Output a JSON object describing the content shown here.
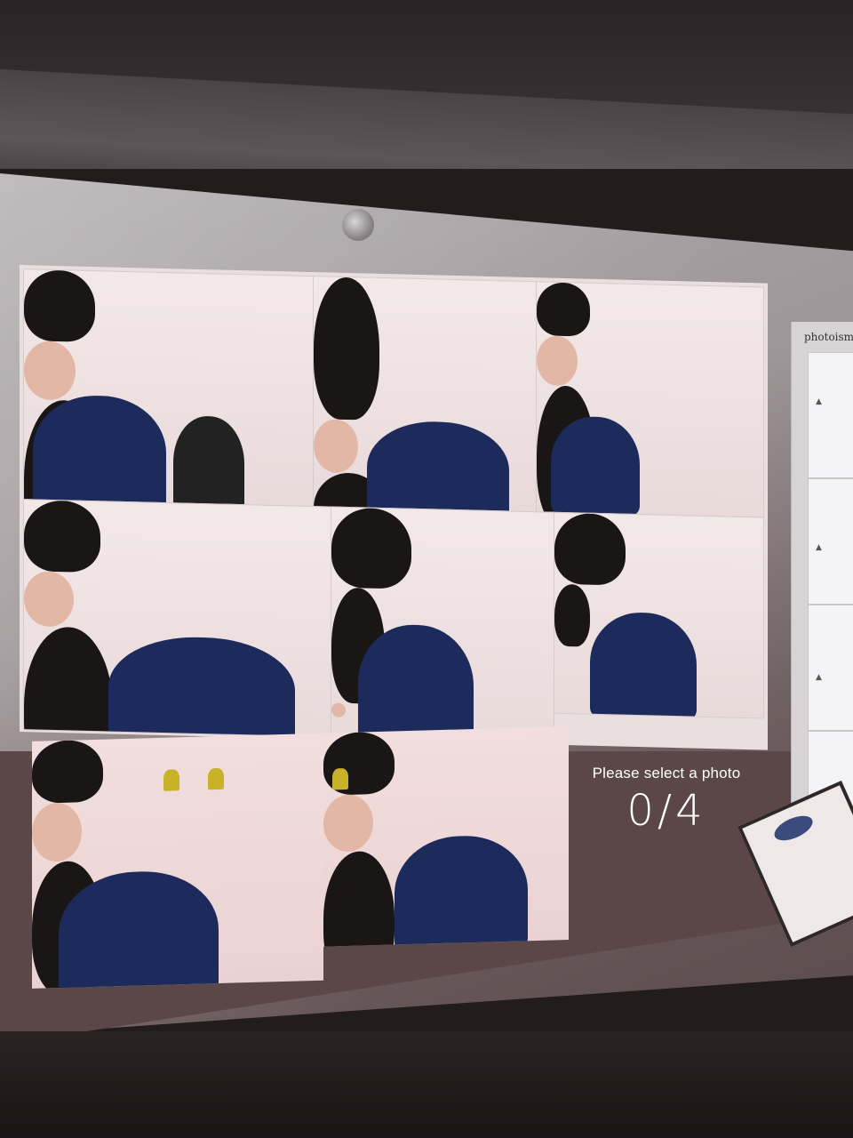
{
  "selection": {
    "prompt": "Please select a photo",
    "counter": "0/4"
  },
  "sidebar": {
    "brand": "photoism",
    "slots": [
      {
        "label": "slot 1"
      },
      {
        "label": "slot 2"
      },
      {
        "label": "slot 3"
      },
      {
        "label": "slot 4"
      }
    ]
  },
  "photos": [
    {
      "label": "photo 1"
    },
    {
      "label": "photo 2"
    },
    {
      "label": "photo 3"
    },
    {
      "label": "photo 4"
    },
    {
      "label": "photo 5"
    },
    {
      "label": "photo 6"
    },
    {
      "label": "photo 7"
    },
    {
      "label": "photo 8"
    }
  ],
  "colors": {
    "accent_shirt": "#1d2a5c",
    "screen_brown": "#5b4748",
    "text": "#ffffff"
  }
}
